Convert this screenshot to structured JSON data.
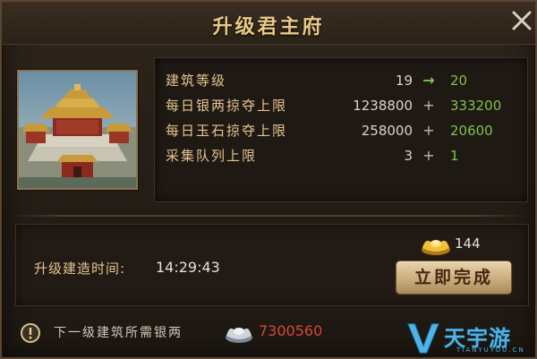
{
  "dialog": {
    "title": "升级君主府",
    "close_icon": "close-icon"
  },
  "building": {
    "image_icon": "palace-building-image"
  },
  "stats": [
    {
      "label": "建筑等级",
      "current": "19",
      "op": "→",
      "next": "20"
    },
    {
      "label": "每日银两掠夺上限",
      "current": "1238800",
      "op": "+",
      "next": "333200"
    },
    {
      "label": "每日玉石掠夺上限",
      "current": "258000",
      "op": "+",
      "next": "20600"
    },
    {
      "label": "采集队列上限",
      "current": "3",
      "op": "+",
      "next": "1"
    }
  ],
  "upgrade": {
    "time_label": "升级建造时间:",
    "time_value": "14:29:43",
    "gold_icon": "gold-ingot-icon",
    "gold_cost": "144",
    "finish_button": "立即完成"
  },
  "footer": {
    "warning_icon": "exclamation-icon",
    "cost_label": "下一级建筑所需银两",
    "silver_icon": "silver-ingot-icon",
    "cost_value": "7300560"
  },
  "watermark": {
    "text": "天宇游",
    "sub": "TIANYUYOU.CN"
  },
  "colors": {
    "accent_gold": "#e3c48e",
    "increase_green": "#7fc34a",
    "insufficient_red": "#d7463a"
  }
}
